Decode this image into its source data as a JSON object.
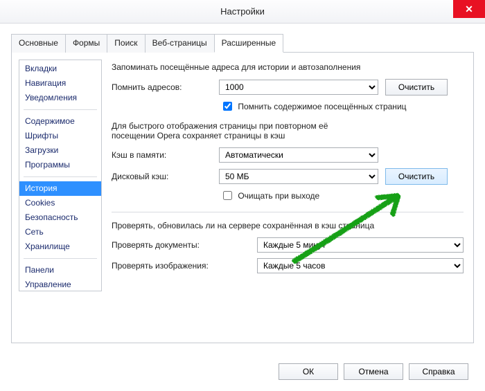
{
  "window": {
    "title": "Настройки"
  },
  "tabs": [
    {
      "label": "Основные"
    },
    {
      "label": "Формы"
    },
    {
      "label": "Поиск"
    },
    {
      "label": "Веб-страницы"
    },
    {
      "label": "Расширенные"
    }
  ],
  "sidebar": {
    "g1": [
      "Вкладки",
      "Навигация",
      "Уведомления"
    ],
    "g2": [
      "Содержимое",
      "Шрифты",
      "Загрузки",
      "Программы"
    ],
    "g3": [
      "История",
      "Cookies",
      "Безопасность",
      "Сеть",
      "Хранилище"
    ],
    "g4": [
      "Панели",
      "Управление"
    ]
  },
  "main": {
    "head1": "Запоминать посещённые адреса для истории и автозаполнения",
    "addr_label": "Помнить адресов:",
    "addr_value": "1000",
    "clear1": "Очистить",
    "chk_content": "Помнить содержимое посещённых страниц",
    "chk_content_checked": true,
    "head2a": "Для быстрого отображения страницы при повторном её",
    "head2b": "посещении Opera сохраняет страницы в кэш",
    "mem_label": "Кэш в памяти:",
    "mem_value": "Автоматически",
    "disk_label": "Дисковый кэш:",
    "disk_value": "50 МБ",
    "clear2": "Очистить",
    "chk_exit": "Очищать при выходе",
    "chk_exit_checked": false,
    "head3": "Проверять, обновилась ли на сервере сохранённая в кэш страница",
    "docs_label": "Проверять документы:",
    "docs_value": "Каждые 5 минут",
    "imgs_label": "Проверять изображения:",
    "imgs_value": "Каждые 5 часов"
  },
  "footer": {
    "ok": "ОК",
    "cancel": "Отмена",
    "help": "Справка"
  }
}
